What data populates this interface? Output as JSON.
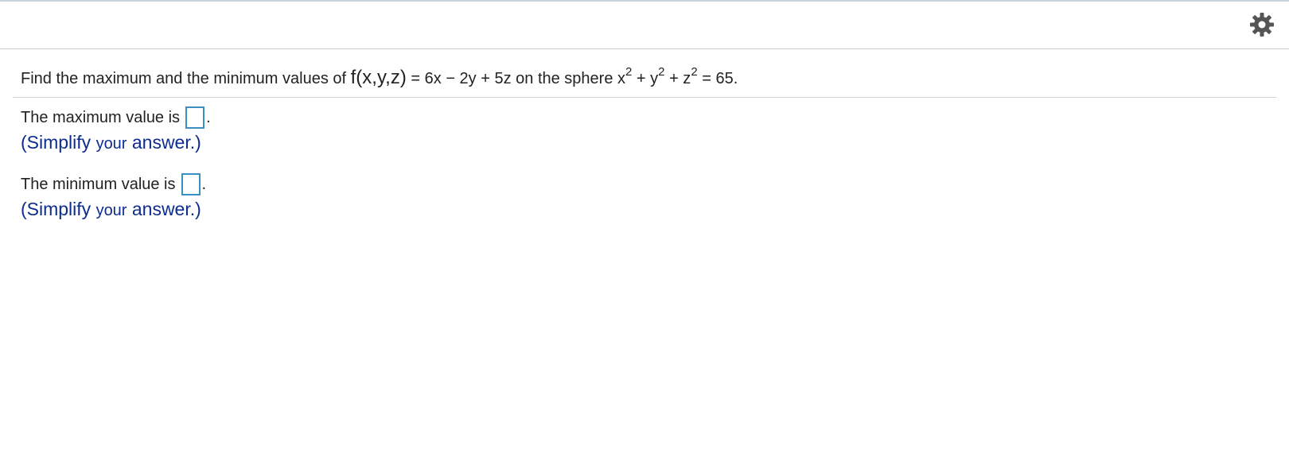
{
  "toolbar": {
    "settings_icon": "gear-icon"
  },
  "question": {
    "prefix": "Find the maximum and the minimum values of",
    "function": "f(x,y,z)",
    "expression": " = 6x − 2y + 5z on the sphere x",
    "exp1": "2",
    "plus_y": " + y",
    "exp2": "2",
    "plus_z": " + z",
    "exp3": "2",
    "suffix": " = 65."
  },
  "max": {
    "label": "The maximum value is",
    "value": "",
    "period": ".",
    "hint_open": "(Simplify",
    "hint_your": "your",
    "hint_close": "answer.)"
  },
  "min": {
    "label": "The minimum value is",
    "value": "",
    "period": ".",
    "hint_open": "(Simplify",
    "hint_your": "your",
    "hint_close": "answer.)"
  },
  "colors": {
    "hint": "#0d2c8f",
    "input_border": "#3b8fc2",
    "gear": "#555555"
  }
}
